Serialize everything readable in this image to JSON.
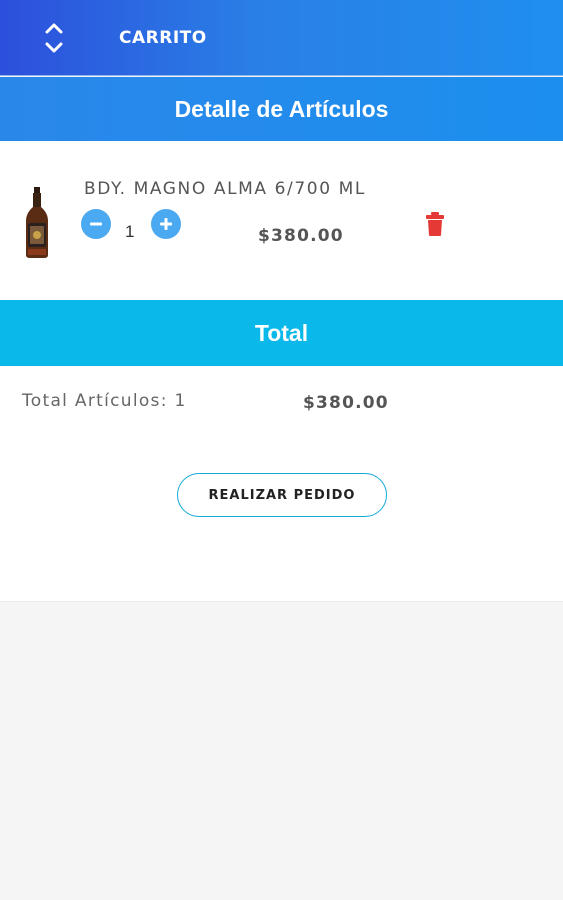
{
  "header": {
    "title": "CARRITO",
    "menu_icon": "unfold-more-icon"
  },
  "detail_section": {
    "title": "Detalle de Artículos"
  },
  "cart_items": [
    {
      "name": "BDY. MAGNO ALMA 6/700 ML",
      "quantity": "1",
      "price": "$380.00",
      "image_icon": "liquor-bottle-icon"
    }
  ],
  "total_section": {
    "title": "Total",
    "items_label": "Total Artículos: 1",
    "amount": "$380.00"
  },
  "actions": {
    "order_label": "REALIZAR PEDIDO"
  },
  "colors": {
    "header_gradient_start": "#2c4fdc",
    "header_gradient_end": "#1f8fef",
    "total_header": "#0ab8ea",
    "qty_button": "#4aa9f0",
    "delete_icon": "#e53935",
    "order_border": "#14a9d8"
  }
}
